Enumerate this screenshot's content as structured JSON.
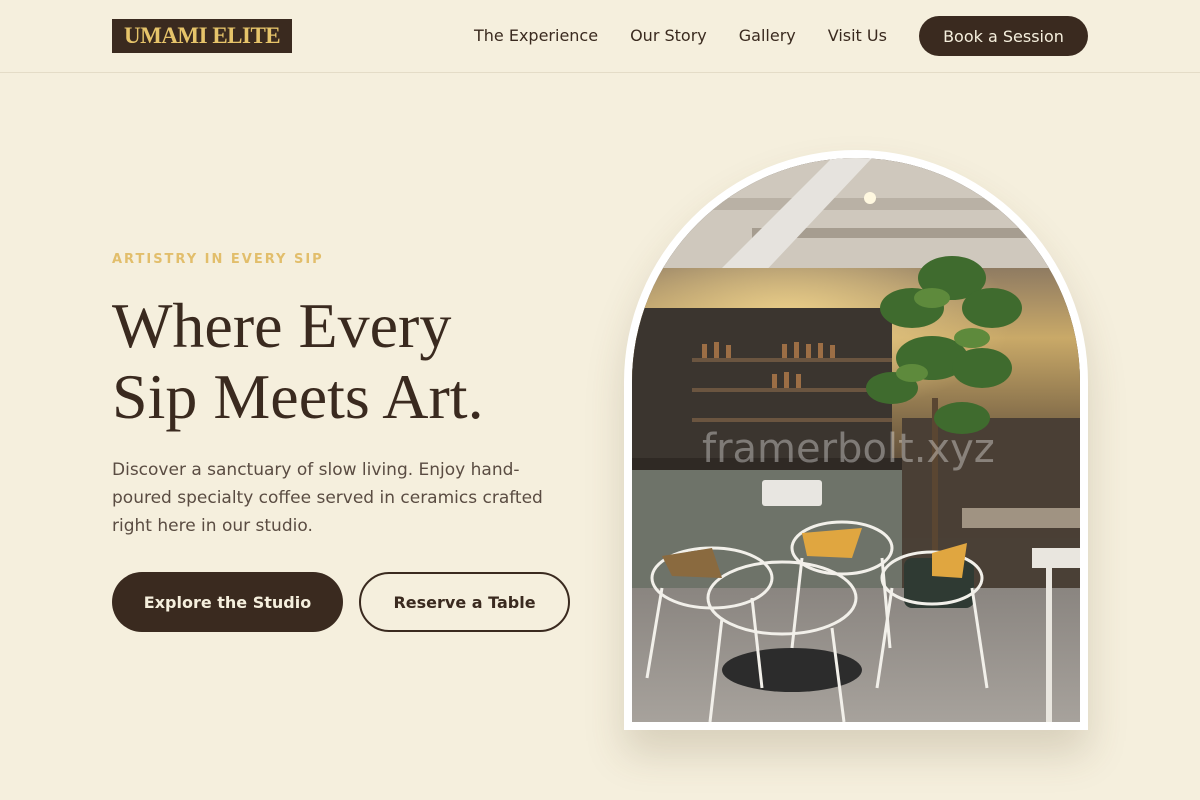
{
  "header": {
    "logo": "UMAMI ELITE",
    "nav": [
      "The Experience",
      "Our Story",
      "Gallery",
      "Visit Us"
    ],
    "cta": "Book a Session"
  },
  "hero": {
    "eyebrow": "ARTISTRY IN EVERY SIP",
    "headline_line1": "Where Every",
    "headline_line2": "Sip Meets Art.",
    "description": "Discover a sanctuary of slow living. Enjoy hand-poured specialty coffee served in ceramics crafted right here in our studio.",
    "primary_button": "Explore the Studio",
    "secondary_button": "Reserve a Table"
  },
  "image": {
    "alt": "Cafe interior with wicker chairs, bar counter and a fiddle leaf fig tree",
    "watermark": "framerbolt.xyz"
  },
  "colors": {
    "background": "#f5efdd",
    "dark": "#3a2a1f",
    "accent": "#e2be6b"
  }
}
